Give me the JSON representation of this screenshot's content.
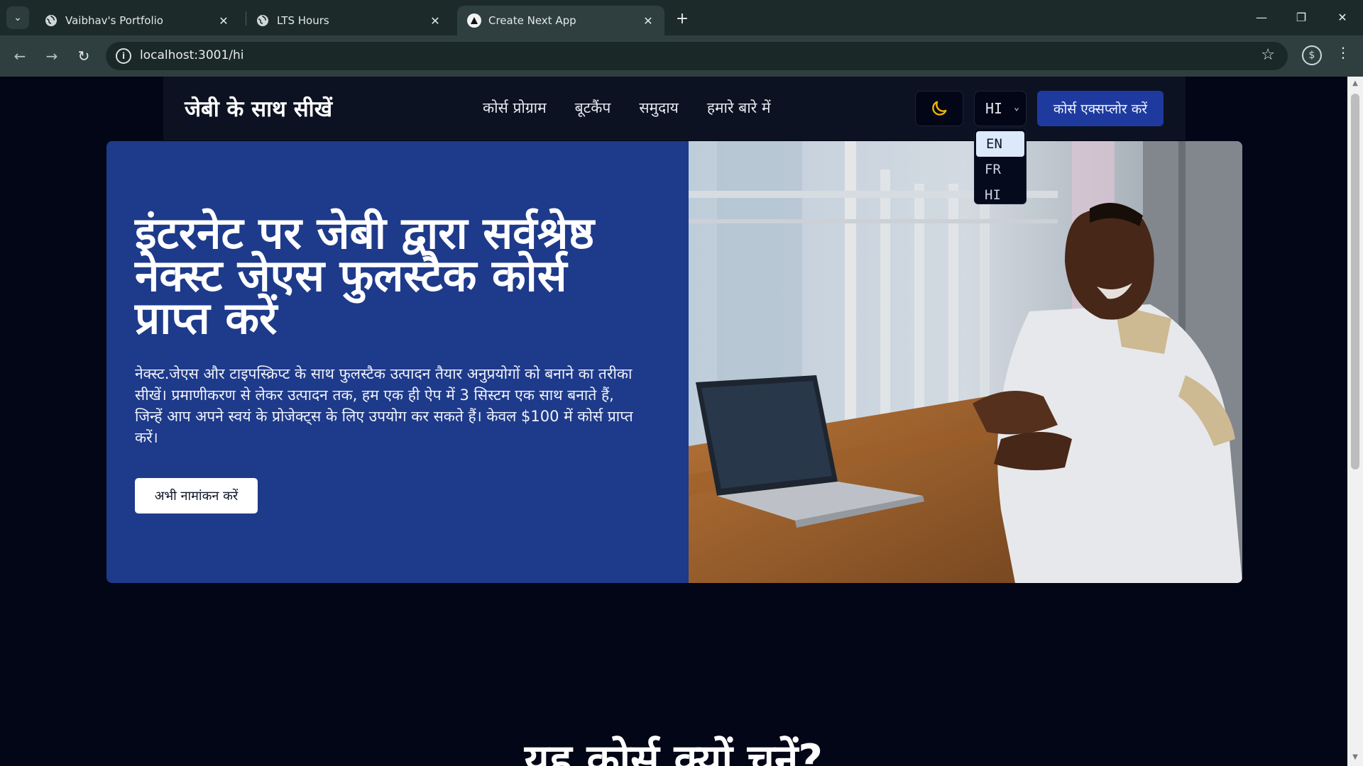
{
  "browser": {
    "tabs": [
      {
        "title": "Vaibhav's Portfolio",
        "icon": "globe-icon"
      },
      {
        "title": "LTS Hours",
        "icon": "globe-icon"
      },
      {
        "title": "Create Next App",
        "icon": "nextjs-triangle-icon"
      }
    ],
    "url": "localhost:3001/hi"
  },
  "site": {
    "logo": "जेबी के साथ सीखें",
    "nav": [
      "कोर्स प्रोग्राम",
      "बूटकैंप",
      "समुदाय",
      "हमारे बारे में"
    ],
    "language": {
      "selected": "HI",
      "options": [
        "EN",
        "FR",
        "HI"
      ],
      "highlighted": "EN"
    },
    "cta": "कोर्स एक्सप्लोर करें",
    "hero": {
      "title": "इंटरनेट पर जेबी द्वारा सर्वश्रेष्ठ नेक्स्ट जेएस फुलस्टैक कोर्स प्राप्त करें",
      "description": "नेक्स्ट.जेएस और टाइपस्क्रिप्ट के साथ फुलस्टैक उत्पादन तैयार अनुप्रयोगों को बनाने का तरीका सीखें। प्रमाणीकरण से लेकर उत्पादन तक, हम एक ही ऐप में 3 सिस्टम एक साथ बनाते हैं, जिन्हें आप अपने स्वयं के प्रोजेक्ट्स के लिए उपयोग कर सकते हैं। केवल $100 में कोर्स प्राप्त करें।",
      "button": "अभी नामांकन करें"
    },
    "section_heading": "यह कोर्स क्यों चुनें?"
  },
  "colors": {
    "hero_bg": "#1e3a8a",
    "cta_bg": "#1e3a9f",
    "page_bg": "#020617",
    "moon": "#f5b700"
  }
}
